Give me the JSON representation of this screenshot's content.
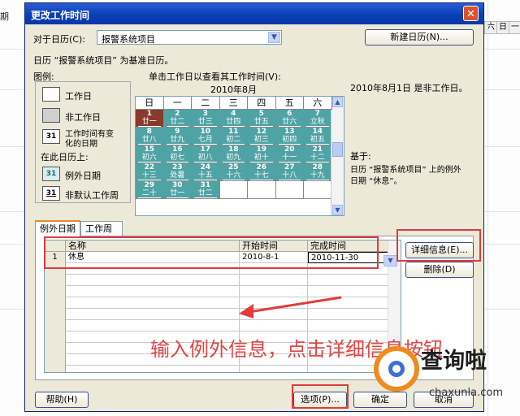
{
  "background": {
    "left_text": "期",
    "right_headers": [
      "六",
      "日",
      "一"
    ]
  },
  "dialog": {
    "title": "更改工作时间",
    "close_glyph": "✕",
    "for_calendar_label": "对于日历(C):",
    "calendar_value": "报警系统项目",
    "new_calendar_button": "新建日历(N)...",
    "base_calendar_text": "日历 “报警系统项目” 为基准日历。",
    "legend": {
      "title": "图例:",
      "working": "工作日",
      "nonworking": "非工作日",
      "edited_line1": "工作时间有变",
      "edited_line2": "化的日期",
      "box_number": "31",
      "on_calendar": "在此日历上:",
      "exception": "例外日期",
      "nondefault": "非默认工作周"
    },
    "calendar": {
      "instruction": "单击工作日以查看其工作时间(V):",
      "month": "2010年8月",
      "weekdays": [
        "日",
        "一",
        "二",
        "三",
        "四",
        "五",
        "六"
      ],
      "days": [
        {
          "d": "1",
          "l": "廿一"
        },
        {
          "d": "2",
          "l": "廿二"
        },
        {
          "d": "3",
          "l": "廿三"
        },
        {
          "d": "4",
          "l": "廿四"
        },
        {
          "d": "5",
          "l": "廿五"
        },
        {
          "d": "6",
          "l": "廿六"
        },
        {
          "d": "7",
          "l": "立秋"
        },
        {
          "d": "8",
          "l": "廿八"
        },
        {
          "d": "9",
          "l": "廿九"
        },
        {
          "d": "10",
          "l": "七月"
        },
        {
          "d": "11",
          "l": "初二"
        },
        {
          "d": "12",
          "l": "初三"
        },
        {
          "d": "13",
          "l": "初四"
        },
        {
          "d": "14",
          "l": "初五"
        },
        {
          "d": "15",
          "l": "初六"
        },
        {
          "d": "16",
          "l": "初七"
        },
        {
          "d": "17",
          "l": "初八"
        },
        {
          "d": "18",
          "l": "初九"
        },
        {
          "d": "19",
          "l": "初十"
        },
        {
          "d": "20",
          "l": "十一"
        },
        {
          "d": "21",
          "l": "十二"
        },
        {
          "d": "22",
          "l": "十三"
        },
        {
          "d": "23",
          "l": "处暑"
        },
        {
          "d": "24",
          "l": "十五"
        },
        {
          "d": "25",
          "l": "十六"
        },
        {
          "d": "26",
          "l": "十七"
        },
        {
          "d": "27",
          "l": "十八"
        },
        {
          "d": "28",
          "l": "十九"
        },
        {
          "d": "29",
          "l": "二十"
        },
        {
          "d": "30",
          "l": "廿一"
        },
        {
          "d": "31",
          "l": "廿二"
        }
      ]
    },
    "info": {
      "date_status": "2010年8月1日 是非工作日。",
      "based_on": "基于:",
      "rule_line1": "日历 “报警系统项目” 上的例外",
      "rule_line2": "日期 “休息”。"
    },
    "tabs": [
      "例外日期",
      "工作周"
    ],
    "table": {
      "headers": [
        "名称",
        "开始时间",
        "完成时间"
      ],
      "rows": [
        {
          "num": "1",
          "name": "休息",
          "start": "2010-8-1",
          "finish": "2010-11-30"
        }
      ]
    },
    "details_button": "详细信息(E)...",
    "delete_button": "删除(D)",
    "help_button": "帮助(H)",
    "options_button": "选项(P)...",
    "ok_button": "确定",
    "cancel_button": "取消"
  },
  "annotation": "输入例外信息，点击详细信息按钮",
  "watermark": {
    "title": "查询啦",
    "url": "chaxunla.com"
  },
  "colors": {
    "working_day": "#4fa3a5",
    "selected_day": "#8a3a2c",
    "annotation": "#e03b3b",
    "title_bar": "#0a3fb6"
  }
}
